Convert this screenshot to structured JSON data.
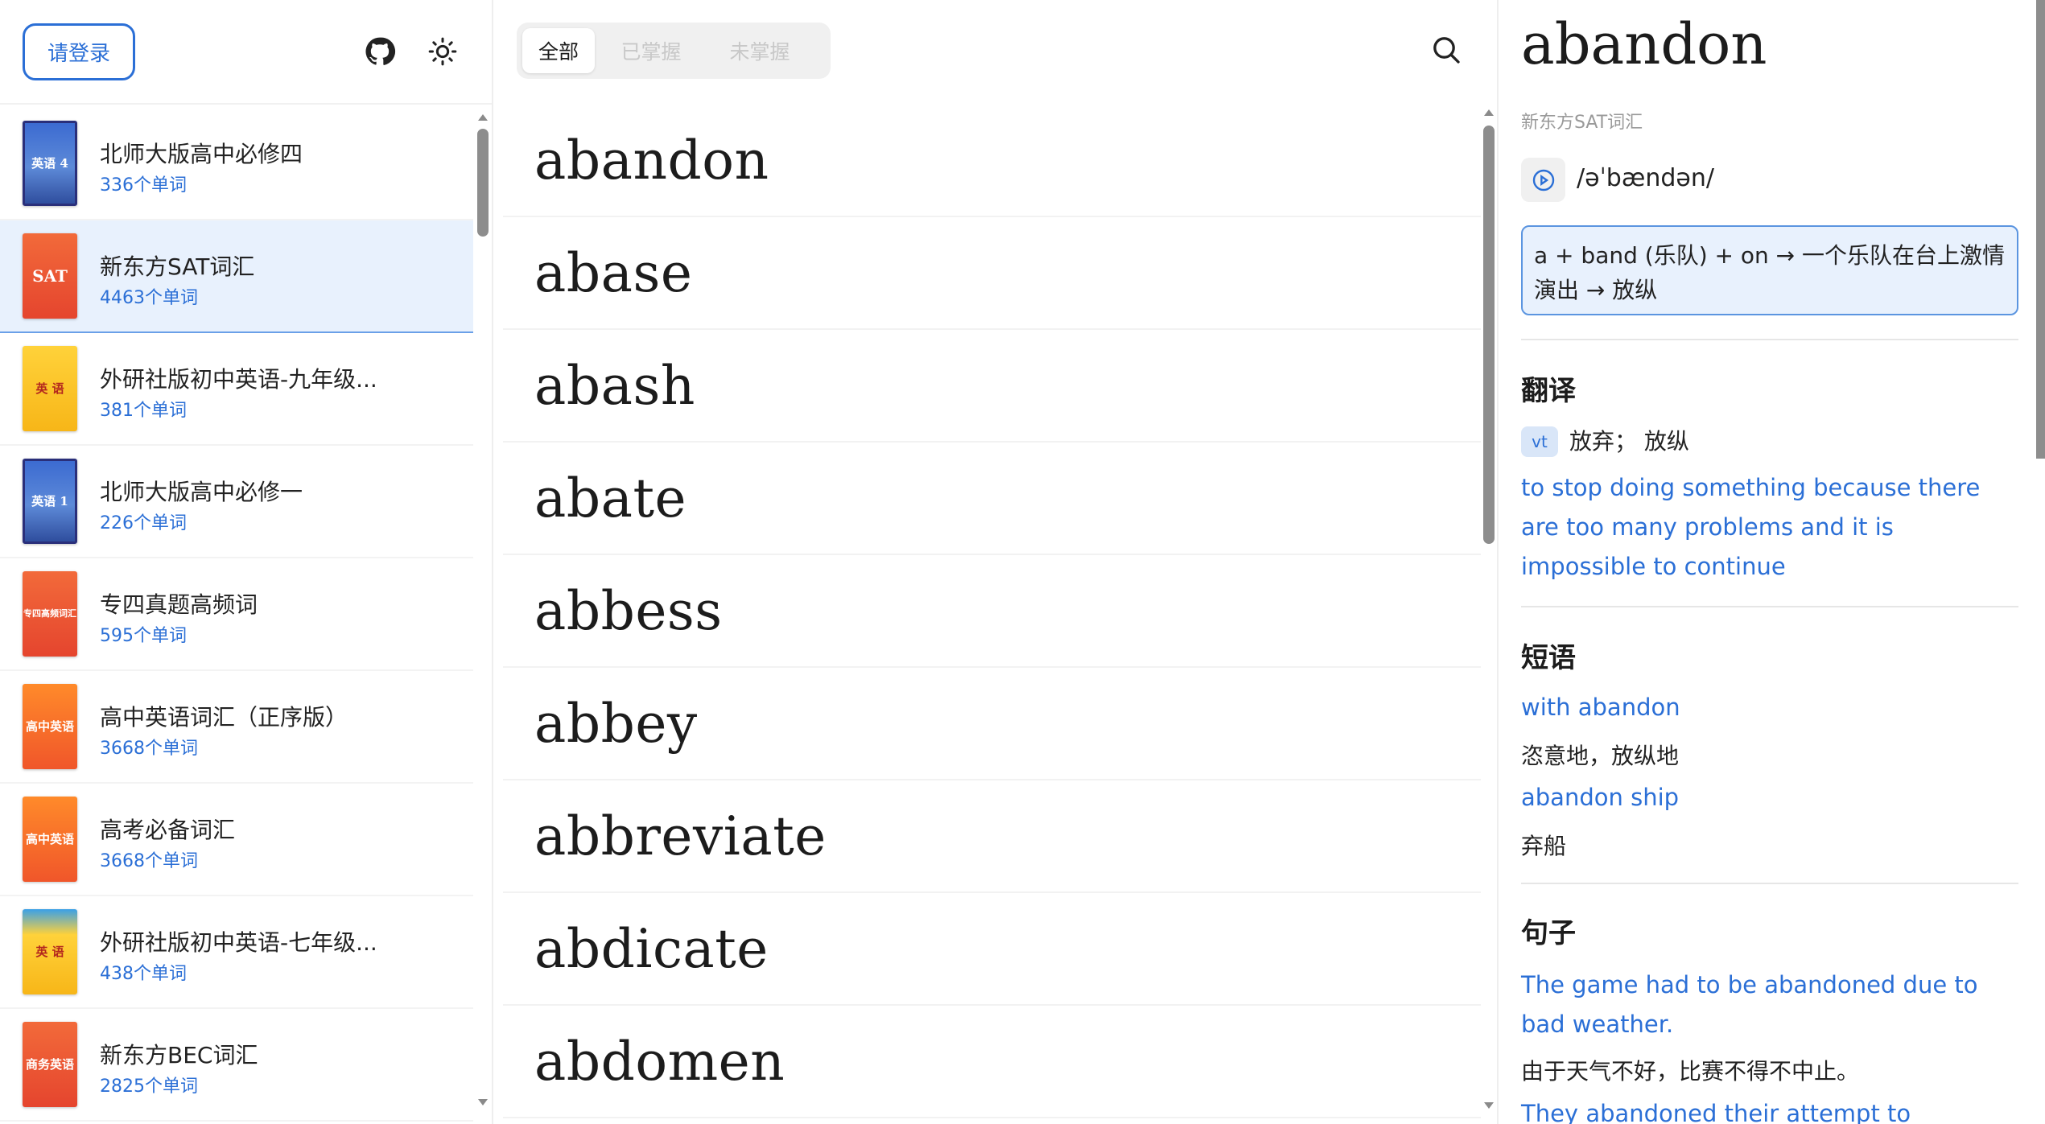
{
  "header": {
    "login_label": "请登录",
    "github_icon": "github-icon",
    "theme_icon": "sun-icon"
  },
  "books": [
    {
      "title": "北师大版高中必修四",
      "count": "336个单词",
      "cover_text": "英语 4",
      "cover_style": "blue",
      "selected": false
    },
    {
      "title": "新东方SAT词汇",
      "count": "4463个单词",
      "cover_text": "SAT",
      "cover_style": "red",
      "selected": true
    },
    {
      "title": "外研社版初中英语-九年级...",
      "count": "381个单词",
      "cover_text": "英 语",
      "cover_style": "yellow",
      "selected": false
    },
    {
      "title": "北师大版高中必修一",
      "count": "226个单词",
      "cover_text": "英语 1",
      "cover_style": "blue",
      "selected": false
    },
    {
      "title": "专四真题高频词",
      "count": "595个单词",
      "cover_text": "专四高频词汇",
      "cover_style": "red",
      "selected": false
    },
    {
      "title": "高中英语词汇（正序版）",
      "count": "3668个单词",
      "cover_text": "高中英语",
      "cover_style": "orange",
      "selected": false
    },
    {
      "title": "高考必备词汇",
      "count": "3668个单词",
      "cover_text": "高中英语",
      "cover_style": "orange",
      "selected": false
    },
    {
      "title": "外研社版初中英语-七年级...",
      "count": "438个单词",
      "cover_text": "英 语",
      "cover_style": "yellowblue",
      "selected": false
    },
    {
      "title": "新东方BEC词汇",
      "count": "2825个单词",
      "cover_text": "商务英语",
      "cover_style": "red",
      "selected": false
    }
  ],
  "filter": {
    "tabs": [
      "全部",
      "已掌握",
      "未掌握"
    ],
    "active_index": 0
  },
  "words": [
    "abandon",
    "abase",
    "abash",
    "abate",
    "abbess",
    "abbey",
    "abbreviate",
    "abdicate",
    "abdomen"
  ],
  "detail": {
    "word": "abandon",
    "book": "新东方SAT词汇",
    "phonetic": "/əˈbændən/",
    "mnemonic_line1": "a + band (乐队) + on → 一个乐队在台上激情",
    "mnemonic_line2": "演出 → 放纵",
    "translation_title": "翻译",
    "pos": "vt",
    "meaning": "放弃；  放纵",
    "definition": "to stop doing something because there are too many problems and it is impossible to continue",
    "phrases_title": "短语",
    "phrases": [
      {
        "en": "with abandon",
        "zh": "恣意地，放纵地"
      },
      {
        "en": "abandon ship",
        "zh": "弃船"
      }
    ],
    "sentences_title": "句子",
    "sentences": [
      {
        "en": "The game had to be abandoned due to bad weather.",
        "zh": "由于天气不好，比赛不得不中止。"
      },
      {
        "en": "They abandoned their attempt to recapture",
        "zh": ""
      }
    ]
  },
  "colors": {
    "accent": "#2b6fd6",
    "selected_bg": "#e8f1fd",
    "text": "#1c1c1c",
    "muted": "#9a9a9a"
  }
}
